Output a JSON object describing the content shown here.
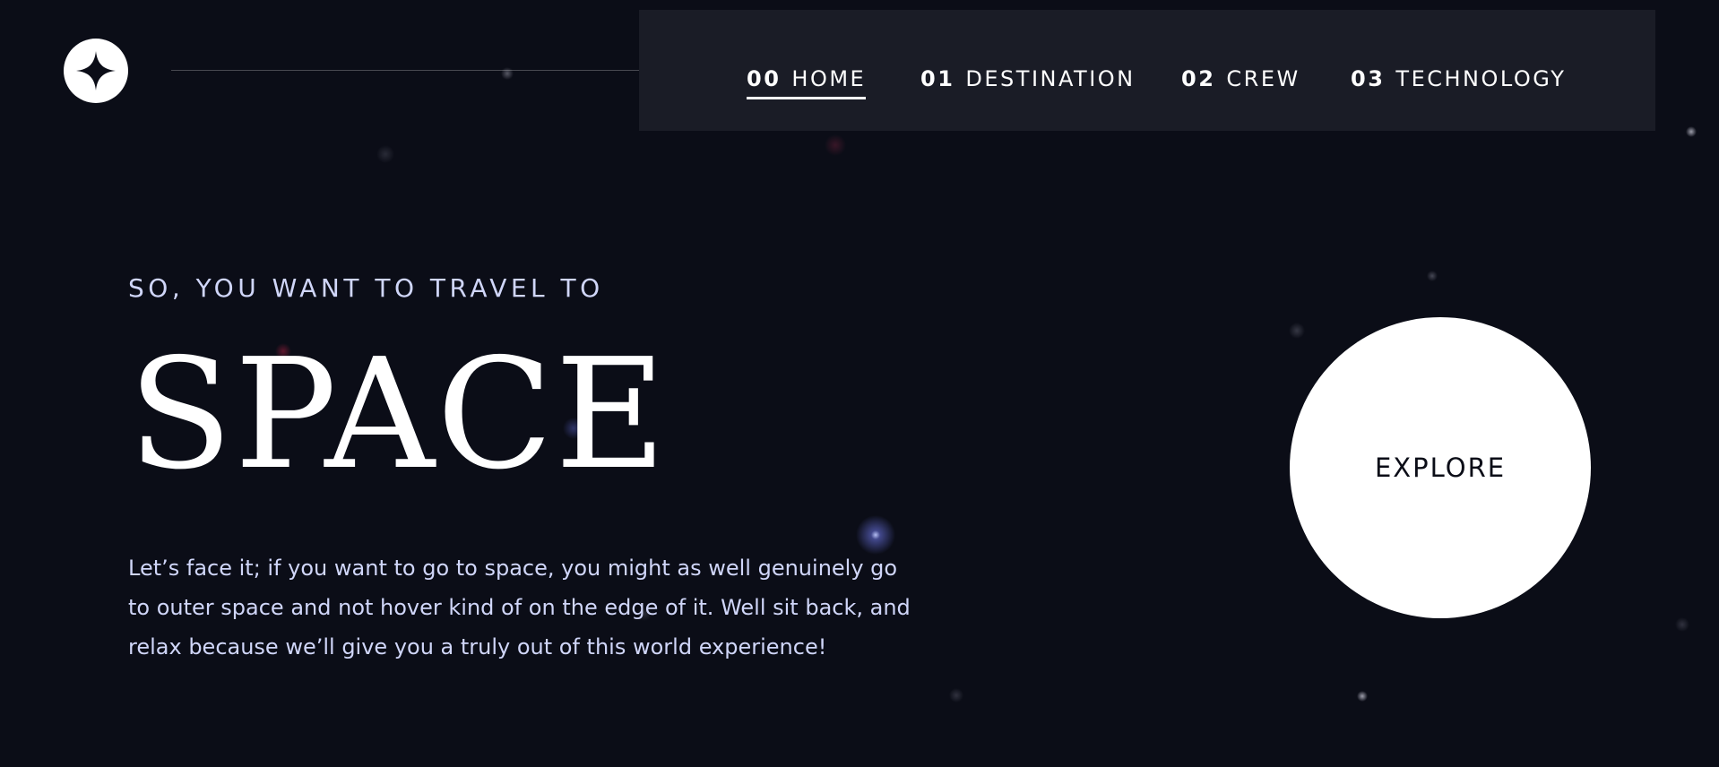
{
  "header": {
    "logo_icon": "four-point-star-icon",
    "nav": [
      {
        "num": "00",
        "label": "HOME",
        "active": true
      },
      {
        "num": "01",
        "label": "DESTINATION",
        "active": false
      },
      {
        "num": "02",
        "label": "CREW",
        "active": false
      },
      {
        "num": "03",
        "label": "TECHNOLOGY",
        "active": false
      }
    ]
  },
  "hero": {
    "subtitle": "SO, YOU WANT TO TRAVEL TO",
    "title": "SPACE",
    "text": "Let’s face it; if you want to go to space, you might as well genuinely go to outer space and not hover kind of on the edge of it. Well sit back, and relax because we’ll give you a truly out of this world experience!",
    "explore_label": "EXPLORE"
  },
  "colors": {
    "background": "#0b0d17",
    "nav_background": "#1a1c26",
    "accent_light": "#d0d6f9",
    "white": "#ffffff"
  }
}
